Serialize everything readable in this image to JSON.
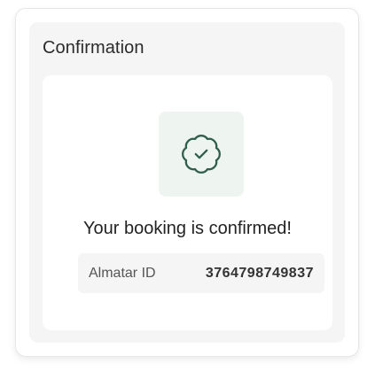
{
  "confirmation": {
    "title": "Confirmation",
    "icon": "badge-check-icon",
    "message": "Your booking is confirmed!",
    "id_label": "Almatar ID",
    "id_value": "3764798749837"
  },
  "colors": {
    "icon_stroke": "#2f5f4b",
    "icon_tile_bg": "#eef4ef",
    "panel_bg": "#f5f5f5"
  }
}
